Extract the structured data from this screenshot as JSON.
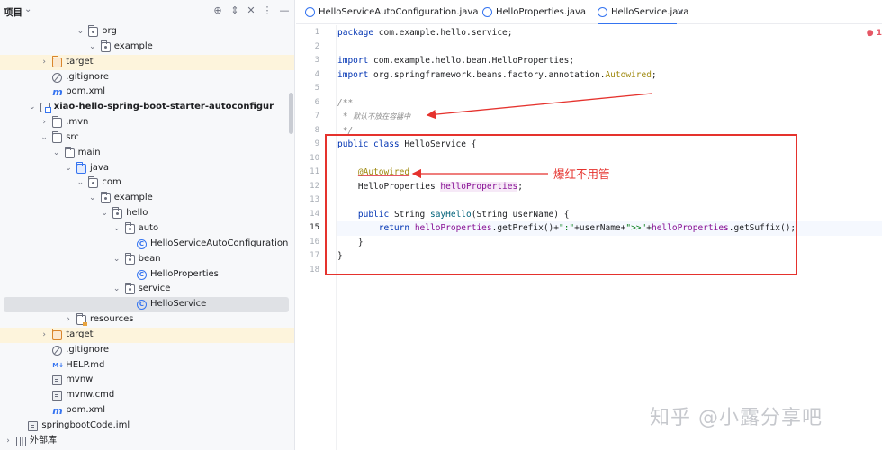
{
  "project_panel": {
    "title": "项目",
    "tree": [
      {
        "label": "org",
        "depth": 6,
        "chevron": "open",
        "icon": "folder-pkg-icon"
      },
      {
        "label": "example",
        "depth": 7,
        "chevron": "open",
        "icon": "folder-pkg-icon"
      },
      {
        "label": "target",
        "depth": 3,
        "chevron": "closed",
        "icon": "folder-orange-icon",
        "highlight": true
      },
      {
        "label": ".gitignore",
        "depth": 3,
        "chevron": "",
        "icon": "gitignore-icon"
      },
      {
        "label": "pom.xml",
        "depth": 3,
        "chevron": "",
        "icon": "maven-icon"
      },
      {
        "label": "xiao-hello-spring-boot-starter-autoconfigur",
        "depth": 2,
        "chevron": "open",
        "icon": "module-icon",
        "bold": true
      },
      {
        "label": ".mvn",
        "depth": 3,
        "chevron": "closed",
        "icon": "folder-icon"
      },
      {
        "label": "src",
        "depth": 3,
        "chevron": "open",
        "icon": "folder-icon"
      },
      {
        "label": "main",
        "depth": 4,
        "chevron": "open",
        "icon": "folder-icon"
      },
      {
        "label": "java",
        "depth": 5,
        "chevron": "open",
        "icon": "folder-blue-icon"
      },
      {
        "label": "com",
        "depth": 6,
        "chevron": "open",
        "icon": "folder-pkg-icon"
      },
      {
        "label": "example",
        "depth": 7,
        "chevron": "open",
        "icon": "folder-pkg-icon"
      },
      {
        "label": "hello",
        "depth": 8,
        "chevron": "open",
        "icon": "folder-pkg-icon"
      },
      {
        "label": "auto",
        "depth": 9,
        "chevron": "open",
        "icon": "folder-pkg-icon"
      },
      {
        "label": "HelloServiceAutoConfiguration",
        "depth": 10,
        "chevron": "",
        "icon": "class-icon"
      },
      {
        "label": "bean",
        "depth": 9,
        "chevron": "open",
        "icon": "folder-pkg-icon"
      },
      {
        "label": "HelloProperties",
        "depth": 10,
        "chevron": "",
        "icon": "class-icon"
      },
      {
        "label": "service",
        "depth": 9,
        "chevron": "open",
        "icon": "folder-pkg-icon"
      },
      {
        "label": "HelloService",
        "depth": 10,
        "chevron": "",
        "icon": "class-icon",
        "selected": true
      },
      {
        "label": "resources",
        "depth": 5,
        "chevron": "closed",
        "icon": "folder-resources-icon"
      },
      {
        "label": "target",
        "depth": 3,
        "chevron": "closed",
        "icon": "folder-orange-icon",
        "highlight": true
      },
      {
        "label": ".gitignore",
        "depth": 3,
        "chevron": "",
        "icon": "gitignore-icon"
      },
      {
        "label": "HELP.md",
        "depth": 3,
        "chevron": "",
        "icon": "markdown-icon"
      },
      {
        "label": "mvnw",
        "depth": 3,
        "chevron": "",
        "icon": "script-icon"
      },
      {
        "label": "mvnw.cmd",
        "depth": 3,
        "chevron": "",
        "icon": "file-icon"
      },
      {
        "label": "pom.xml",
        "depth": 3,
        "chevron": "",
        "icon": "maven-icon"
      },
      {
        "label": "springbootCode.iml",
        "depth": 1,
        "chevron": "",
        "icon": "module-file-icon"
      },
      {
        "label": "外部库",
        "depth": 0,
        "chevron": "closed",
        "icon": "library-icon"
      }
    ]
  },
  "tabs": [
    {
      "label": "HelloServiceAutoConfiguration.java",
      "active": false
    },
    {
      "label": "HelloProperties.java",
      "active": false
    },
    {
      "label": "HelloService.java",
      "active": true
    }
  ],
  "editor": {
    "line_numbers": [
      "1",
      "2",
      "3",
      "4",
      "5",
      "6",
      "7",
      "8",
      "9",
      "10",
      "11",
      "12",
      "13",
      "14",
      "15",
      "16",
      "17",
      "18"
    ],
    "current_line": 15,
    "error_count": "1",
    "code_lines": [
      [
        {
          "t": "package",
          "c": "kw"
        },
        {
          "t": " com.example.hello.service;",
          "c": ""
        }
      ],
      [],
      [
        {
          "t": "import",
          "c": "kw"
        },
        {
          "t": " com.example.hello.bean.HelloProperties;",
          "c": ""
        }
      ],
      [
        {
          "t": "import",
          "c": "kw"
        },
        {
          "t": " org.springframework.beans.factory.annotation.",
          "c": ""
        },
        {
          "t": "Autowired",
          "c": "ann"
        },
        {
          "t": ";",
          "c": ""
        }
      ],
      [],
      [
        {
          "t": "/**",
          "c": "cmt"
        }
      ],
      [
        {
          "t": " * ",
          "c": "cmt"
        },
        {
          "t": "默认不放在容器中",
          "c": "cmt-small"
        }
      ],
      [
        {
          "t": " */",
          "c": "cmt"
        }
      ],
      [
        {
          "t": "public class",
          "c": "kw"
        },
        {
          "t": " HelloService {",
          "c": ""
        }
      ],
      [],
      [
        {
          "t": "    ",
          "c": ""
        },
        {
          "t": "@Autowired",
          "c": "ann-err"
        }
      ],
      [
        {
          "t": "    HelloProperties ",
          "c": ""
        },
        {
          "t": "helloProperties",
          "c": "fld-u"
        },
        {
          "t": ";",
          "c": ""
        }
      ],
      [],
      [
        {
          "t": "    ",
          "c": ""
        },
        {
          "t": "public",
          "c": "kw"
        },
        {
          "t": " String ",
          "c": ""
        },
        {
          "t": "sayHello",
          "c": "mth"
        },
        {
          "t": "(String userName) {",
          "c": ""
        }
      ],
      [
        {
          "t": "        ",
          "c": ""
        },
        {
          "t": "return",
          "c": "kw"
        },
        {
          "t": " ",
          "c": ""
        },
        {
          "t": "helloProperties",
          "c": "fld"
        },
        {
          "t": ".getPrefix()+",
          "c": ""
        },
        {
          "t": "\":\"",
          "c": "str"
        },
        {
          "t": "+userName+",
          "c": ""
        },
        {
          "t": "\">>\"",
          "c": "str"
        },
        {
          "t": "+",
          "c": ""
        },
        {
          "t": "helloProperties",
          "c": "fld"
        },
        {
          "t": ".getSuffix();",
          "c": ""
        }
      ],
      [
        {
          "t": "    }",
          "c": ""
        }
      ],
      [
        {
          "t": "}",
          "c": ""
        }
      ],
      []
    ]
  },
  "annotation": {
    "label": "爆红不用管",
    "color": "#e5322d"
  },
  "watermark": "知乎 @小露分享吧",
  "colors": {
    "keyword": "#0033b3",
    "annotation": "#9e880d",
    "field": "#871094",
    "method": "#00627a",
    "string": "#067d17",
    "comment": "#8c8c8c",
    "accent": "#3574f0",
    "highlight_folder": "#fdf4dc"
  }
}
